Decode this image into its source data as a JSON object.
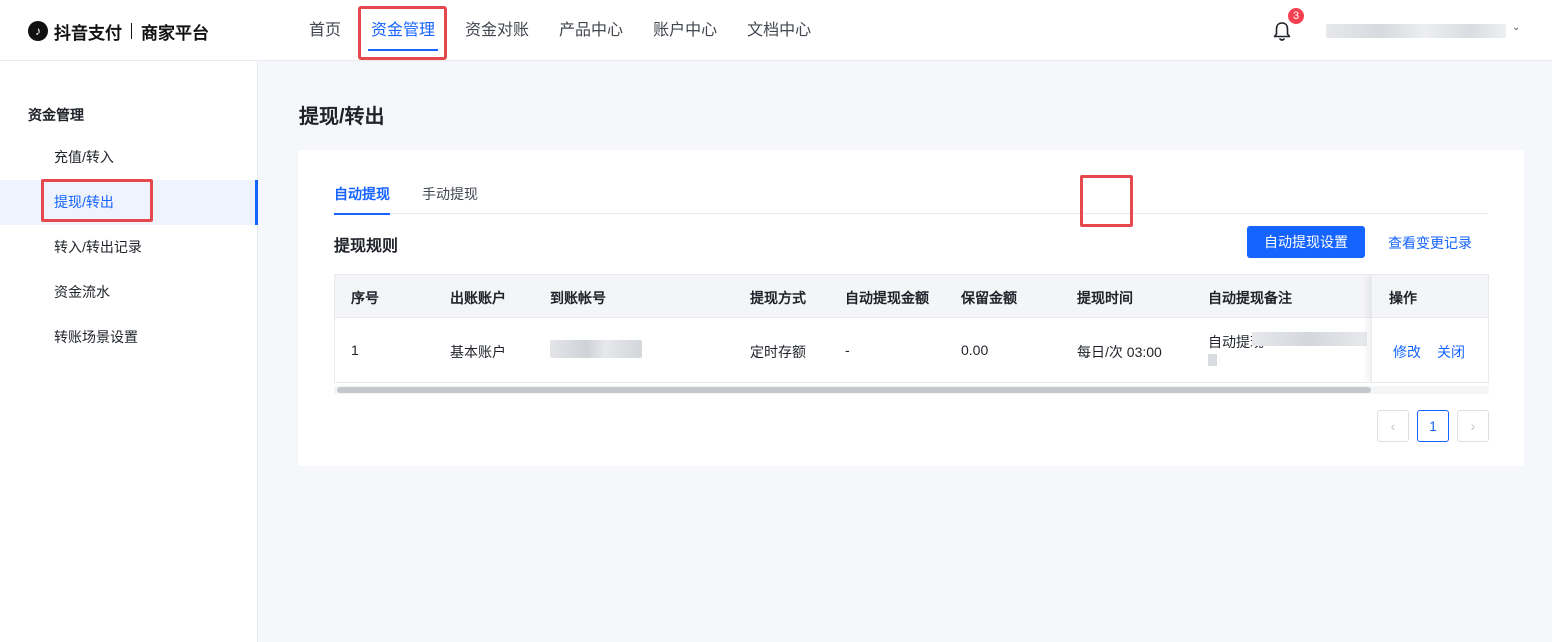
{
  "header": {
    "logo_icon": "tiktok-note-icon",
    "brand": "抖音支付",
    "brand_sub": "商家平台",
    "nav": [
      "首页",
      "资金管理",
      "资金对账",
      "产品中心",
      "账户中心",
      "文档中心"
    ],
    "active_nav": "资金管理",
    "notification_count": "3",
    "user_caret": "⌄"
  },
  "sidebar": {
    "title": "资金管理",
    "items": [
      "充值/转入",
      "提现/转出",
      "转入/转出记录",
      "资金流水",
      "转账场景设置"
    ],
    "active_item": "提现/转出"
  },
  "main": {
    "page_title": "提现/转出",
    "tabs": [
      "自动提现",
      "手动提现"
    ],
    "active_tab": "自动提现",
    "section_title": "提现规则",
    "primary_button": "自动提现设置",
    "history_link": "查看变更记录",
    "table": {
      "columns": [
        "序号",
        "出账账户",
        "到账帐号",
        "提现方式",
        "自动提现金额",
        "保留金额",
        "提现时间",
        "自动提现备注",
        "操作"
      ],
      "rows": [
        {
          "index": "1",
          "out_account": "基本账户",
          "to_account": "",
          "method": "定时存额",
          "auto_amount": "-",
          "reserved_amount": "0.00",
          "time": "每日/次 03:00",
          "note": "自动提现",
          "actions": [
            "修改",
            "关闭"
          ]
        }
      ]
    },
    "pagination": {
      "prev": "‹",
      "current_page": "1",
      "next": "›"
    }
  },
  "colors": {
    "accent": "#1664ff",
    "highlight_box": "#e5484d",
    "badge": "#f5414f"
  }
}
